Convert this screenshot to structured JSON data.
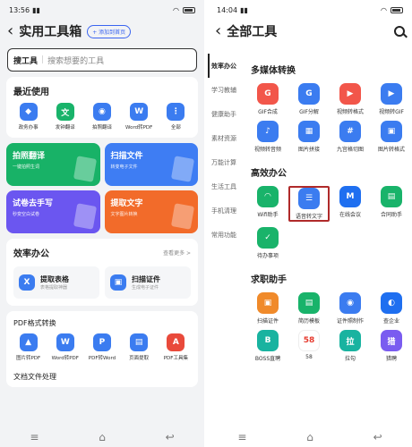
{
  "left": {
    "status": {
      "time": "13:56",
      "battery": "100"
    },
    "title": "实用工具箱",
    "add_btn": "+ 添加到首页",
    "search": {
      "keyword": "搜工具",
      "placeholder": "搜索想要的工具"
    },
    "recent": {
      "title": "最近使用",
      "items": [
        {
          "label": "政务办事",
          "icon": "shield-icon",
          "color": "#3b7cf0",
          "glyph": "◆"
        },
        {
          "label": "发钟翻译",
          "icon": "translate-icon",
          "color": "#19b36a",
          "glyph": "文"
        },
        {
          "label": "拍照翻译",
          "icon": "camera-icon",
          "color": "#3b7cf0",
          "glyph": "◉"
        },
        {
          "label": "Word转PDF",
          "icon": "word-icon",
          "color": "#3b7cf0",
          "glyph": "W"
        },
        {
          "label": "全部",
          "icon": "grid-icon",
          "color": "#3b7cf0",
          "glyph": "⋮"
        }
      ]
    },
    "tiles": [
      {
        "title": "拍照翻译",
        "sub": "一键拍照生词",
        "color": "#18b267"
      },
      {
        "title": "扫描文件",
        "sub": "转变电子文件",
        "color": "#3e7df3"
      },
      {
        "title": "试卷去手写",
        "sub": "秒变空白试卷",
        "color": "#6b56f0"
      },
      {
        "title": "提取文字",
        "sub": "文字图片转换",
        "color": "#f26b2a"
      }
    ],
    "efficiency": {
      "title": "效率办公",
      "more": "查看更多 >",
      "cards": [
        {
          "title": "提取表格",
          "sub": "表格提取神器",
          "color": "#3b7cf0",
          "glyph": "X"
        },
        {
          "title": "扫描证件",
          "sub": "生成电子证件",
          "color": "#3b7cf0",
          "glyph": "▣"
        }
      ]
    },
    "pdf": {
      "title": "PDF格式转换",
      "items": [
        {
          "label": "图片转PDF",
          "icon": "image-pdf-icon",
          "color": "#3b7cf0",
          "glyph": "▲"
        },
        {
          "label": "Word转PDF",
          "icon": "word-icon",
          "color": "#3b7cf0",
          "glyph": "W"
        },
        {
          "label": "PDF转Word",
          "icon": "pdf-word-icon",
          "color": "#3b7cf0",
          "glyph": "P"
        },
        {
          "label": "页面提取",
          "icon": "page-icon",
          "color": "#3b7cf0",
          "glyph": "▤"
        },
        {
          "label": "PDF工具集",
          "icon": "pdf-tools-icon",
          "color": "#e94a3b",
          "glyph": "A"
        }
      ]
    },
    "doc_title": "文档文件处理"
  },
  "right": {
    "status": {
      "time": "14:04",
      "battery": "100"
    },
    "title": "全部工具",
    "side": [
      "效率办公",
      "学习教辅",
      "健康助手",
      "素材资源",
      "万能计算",
      "生活工具",
      "手机清理",
      "常用功能"
    ],
    "multimedia": {
      "title": "多媒体转换",
      "items": [
        {
          "label": "GIF合成",
          "color": "#f2564a",
          "glyph": "G"
        },
        {
          "label": "GIF分解",
          "color": "#3b7cf0",
          "glyph": "G"
        },
        {
          "label": "视频转格式",
          "color": "#f2564a",
          "glyph": "▶"
        },
        {
          "label": "视频转GIF",
          "color": "#3b7cf0",
          "glyph": "▶"
        },
        {
          "label": "视频转音频",
          "color": "#3b7cf0",
          "glyph": "♪"
        },
        {
          "label": "图片拼接",
          "color": "#3b7cf0",
          "glyph": "▦"
        },
        {
          "label": "九宫格切图",
          "color": "#3b7cf0",
          "glyph": "#"
        },
        {
          "label": "图片转格式",
          "color": "#3b7cf0",
          "glyph": "▣"
        }
      ]
    },
    "office": {
      "title": "高效办公",
      "items": [
        {
          "label": "Wifi助手",
          "color": "#19b36a",
          "glyph": "◠"
        },
        {
          "label": "语音转文字",
          "color": "#3b7cf0",
          "glyph": "☰"
        },
        {
          "label": "在线会议",
          "color": "#1f6ff0",
          "glyph": "M"
        },
        {
          "label": "合同助手",
          "color": "#19b36a",
          "glyph": "▤"
        },
        {
          "label": "待办事项",
          "color": "#19b36a",
          "glyph": "✓"
        }
      ]
    },
    "job": {
      "title": "求职助手",
      "items": [
        {
          "label": "扫描证件",
          "color": "#f08a2a",
          "glyph": "▣"
        },
        {
          "label": "简历模板",
          "color": "#19b36a",
          "glyph": "▤"
        },
        {
          "label": "证件照制作",
          "color": "#3b7cf0",
          "glyph": "◉"
        },
        {
          "label": "查企业",
          "color": "#1f6ff0",
          "glyph": "◐"
        },
        {
          "label": "BOSS直聘",
          "color": "#19b3a0",
          "glyph": "B"
        },
        {
          "label": "58",
          "color": "#ffffff",
          "glyph": "58"
        },
        {
          "label": "拉勾",
          "color": "#19b3a0",
          "glyph": "拉"
        },
        {
          "label": "猎聘",
          "color": "#7a5cf0",
          "glyph": "猎"
        }
      ]
    }
  }
}
